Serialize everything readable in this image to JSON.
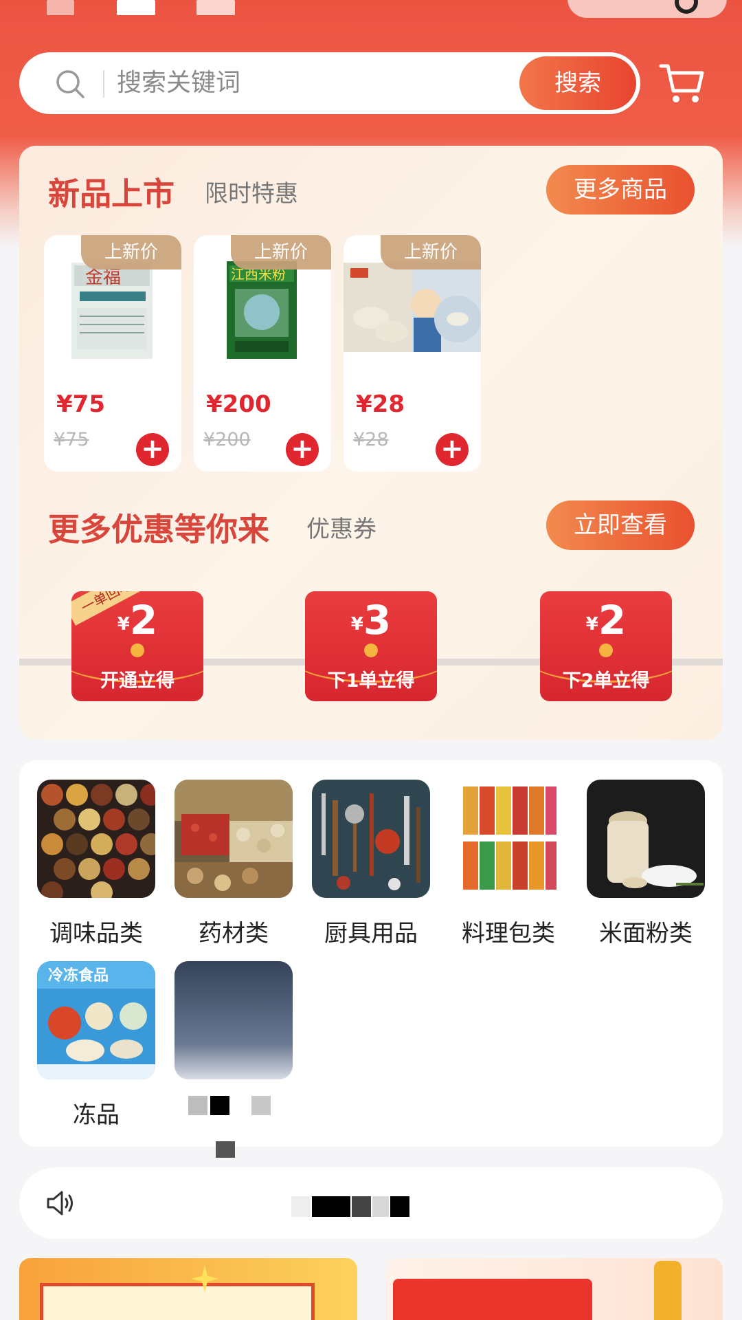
{
  "search": {
    "placeholder": "搜索关键词",
    "button_label": "搜索"
  },
  "new_products": {
    "title": "新品上市",
    "subtitle": "限时特惠",
    "more_label": "更多商品",
    "items": [
      {
        "tag": "上新价",
        "price": "¥75",
        "old_price": "¥75"
      },
      {
        "tag": "上新价",
        "price": "¥200",
        "old_price": "¥200"
      },
      {
        "tag": "上新价",
        "price": "¥28",
        "old_price": "¥28"
      }
    ]
  },
  "coupons": {
    "title": "更多优惠等你来",
    "subtitle": "优惠券",
    "view_label": "立即查看",
    "ribbon": "一单回本",
    "currency": "¥",
    "items": [
      {
        "amount": "2",
        "label": "开通立得"
      },
      {
        "amount": "3",
        "label": "下1单立得"
      },
      {
        "amount": "2",
        "label": "下2单立得"
      }
    ]
  },
  "categories": [
    {
      "label": "调味品类",
      "icon": "spices-image"
    },
    {
      "label": "药材类",
      "icon": "herbs-image"
    },
    {
      "label": "厨具用品",
      "icon": "kitchenware-image"
    },
    {
      "label": "料理包类",
      "icon": "meal-pack-image"
    },
    {
      "label": "米面粉类",
      "icon": "flour-rice-image"
    },
    {
      "label": "冻品",
      "icon": "frozen-food-image"
    },
    {
      "label": "",
      "icon": "unknown-image"
    }
  ],
  "colors": {
    "brand_red": "#ec5442",
    "price_red": "#e0262e",
    "accent_orange": "#f2764a"
  }
}
